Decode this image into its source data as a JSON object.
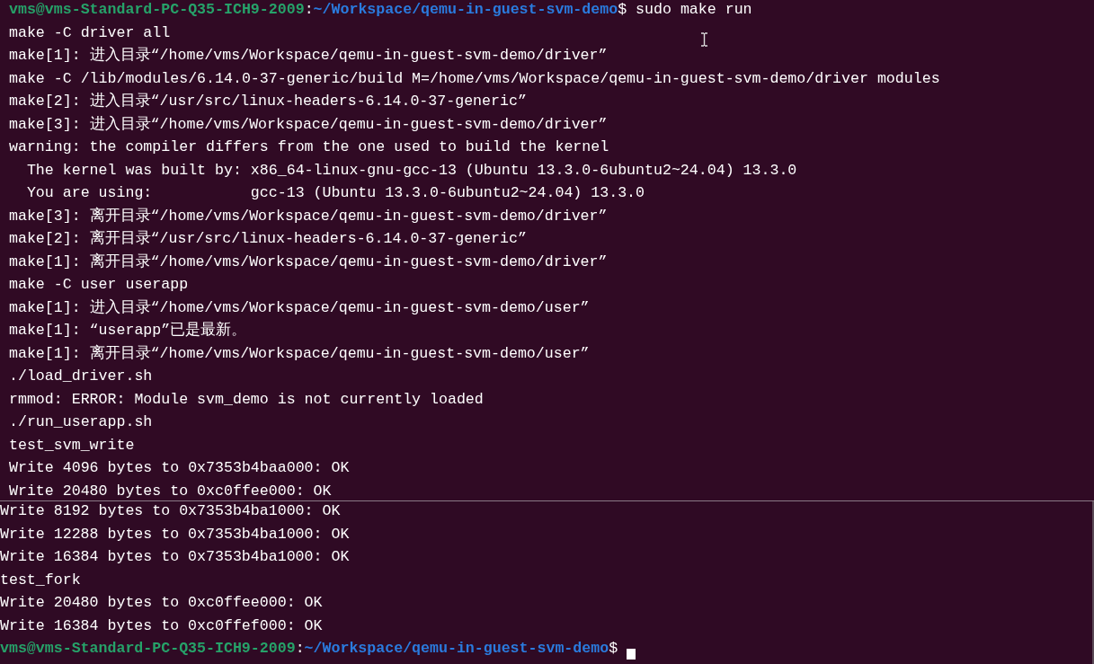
{
  "panes": [
    {
      "lines": [
        {
          "kind": "prompt",
          "user_host": "vms@vms-Standard-PC-Q35-ICH9-2009",
          "separator": ":",
          "path": "~/Workspace/qemu-in-guest-svm-demo",
          "symbol": "$",
          "command": " sudo make run"
        },
        {
          "kind": "output",
          "text": "make -C driver all"
        },
        {
          "kind": "output",
          "text": "make[1]: 进入目录“/home/vms/Workspace/qemu-in-guest-svm-demo/driver”"
        },
        {
          "kind": "output",
          "text": "make -C /lib/modules/6.14.0-37-generic/build M=/home/vms/Workspace/qemu-in-guest-svm-demo/driver modules"
        },
        {
          "kind": "output",
          "text": "make[2]: 进入目录“/usr/src/linux-headers-6.14.0-37-generic”"
        },
        {
          "kind": "output",
          "text": "make[3]: 进入目录“/home/vms/Workspace/qemu-in-guest-svm-demo/driver”"
        },
        {
          "kind": "output",
          "text": "warning: the compiler differs from the one used to build the kernel"
        },
        {
          "kind": "output",
          "text": "  The kernel was built by: x86_64-linux-gnu-gcc-13 (Ubuntu 13.3.0-6ubuntu2~24.04) 13.3.0"
        },
        {
          "kind": "output",
          "text": "  You are using:           gcc-13 (Ubuntu 13.3.0-6ubuntu2~24.04) 13.3.0"
        },
        {
          "kind": "output",
          "text": "make[3]: 离开目录“/home/vms/Workspace/qemu-in-guest-svm-demo/driver”"
        },
        {
          "kind": "output",
          "text": "make[2]: 离开目录“/usr/src/linux-headers-6.14.0-37-generic”"
        },
        {
          "kind": "output",
          "text": "make[1]: 离开目录“/home/vms/Workspace/qemu-in-guest-svm-demo/driver”"
        },
        {
          "kind": "output",
          "text": "make -C user userapp"
        },
        {
          "kind": "output",
          "text": "make[1]: 进入目录“/home/vms/Workspace/qemu-in-guest-svm-demo/user”"
        },
        {
          "kind": "output",
          "text": "make[1]: “userapp”已是最新。"
        },
        {
          "kind": "output",
          "text": "make[1]: 离开目录“/home/vms/Workspace/qemu-in-guest-svm-demo/user”"
        },
        {
          "kind": "output",
          "text": "./load_driver.sh"
        },
        {
          "kind": "output",
          "text": "rmmod: ERROR: Module svm_demo is not currently loaded"
        },
        {
          "kind": "output",
          "text": "./run_userapp.sh"
        },
        {
          "kind": "output",
          "text": "test_svm_write"
        },
        {
          "kind": "output",
          "text": "Write 4096 bytes to 0x7353b4baa000: OK"
        },
        {
          "kind": "output",
          "text": "Write 20480 bytes to 0xc0ffee000: OK"
        }
      ]
    },
    {
      "lines": [
        {
          "kind": "output",
          "text": "Write 8192 bytes to 0x7353b4ba1000: OK"
        },
        {
          "kind": "output",
          "text": "Write 12288 bytes to 0x7353b4ba1000: OK"
        },
        {
          "kind": "output",
          "text": "Write 16384 bytes to 0x7353b4ba1000: OK"
        },
        {
          "kind": "output",
          "text": "test_fork"
        },
        {
          "kind": "output",
          "text": "Write 20480 bytes to 0xc0ffee000: OK"
        },
        {
          "kind": "output",
          "text": "Write 16384 bytes to 0xc0ffef000: OK"
        },
        {
          "kind": "prompt",
          "user_host": "vms@vms-Standard-PC-Q35-ICH9-2009",
          "separator": ":",
          "path": "~/Workspace/qemu-in-guest-svm-demo",
          "symbol": "$"
        }
      ]
    }
  ]
}
